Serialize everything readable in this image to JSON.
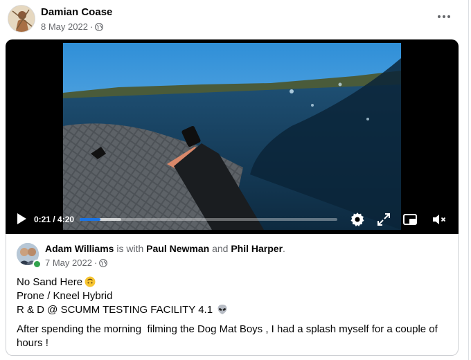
{
  "post": {
    "author": "Damian Coase",
    "date": "8 May 2022",
    "separator": "·",
    "privacy_icon": "globe-icon",
    "more_icon": "more-options-icon"
  },
  "video": {
    "current_time": "0:21",
    "time_sep": " / ",
    "duration": "4:20",
    "progress_fraction": 0.081,
    "buffered_fraction": 0.16,
    "icons": [
      "play-icon",
      "settings-icon",
      "fullscreen-icon",
      "picture-in-picture-icon",
      "mute-icon"
    ]
  },
  "shared_post": {
    "author": "Adam Williams",
    "with_text": " is with ",
    "tag1": "Paul Newman",
    "and_text": " and ",
    "tag2": "Phil Harper",
    "end_text": ".",
    "date": "7 May 2022",
    "separator": "·",
    "lines": [
      "No Sand Here",
      "Prone / Kneel Hybrid",
      "R & D @ SCUMM TESTING FACILITY 4.1"
    ],
    "paragraph": "After spending the morning  filming the Dog Mat Boys , I had a splash myself for a couple of hours !",
    "emojis": [
      "upside-down-face-emoji",
      "alien-emoji"
    ]
  },
  "colors": {
    "accent": "#1b74e4",
    "secondary_text": "#65676b",
    "online": "#31a24c"
  }
}
